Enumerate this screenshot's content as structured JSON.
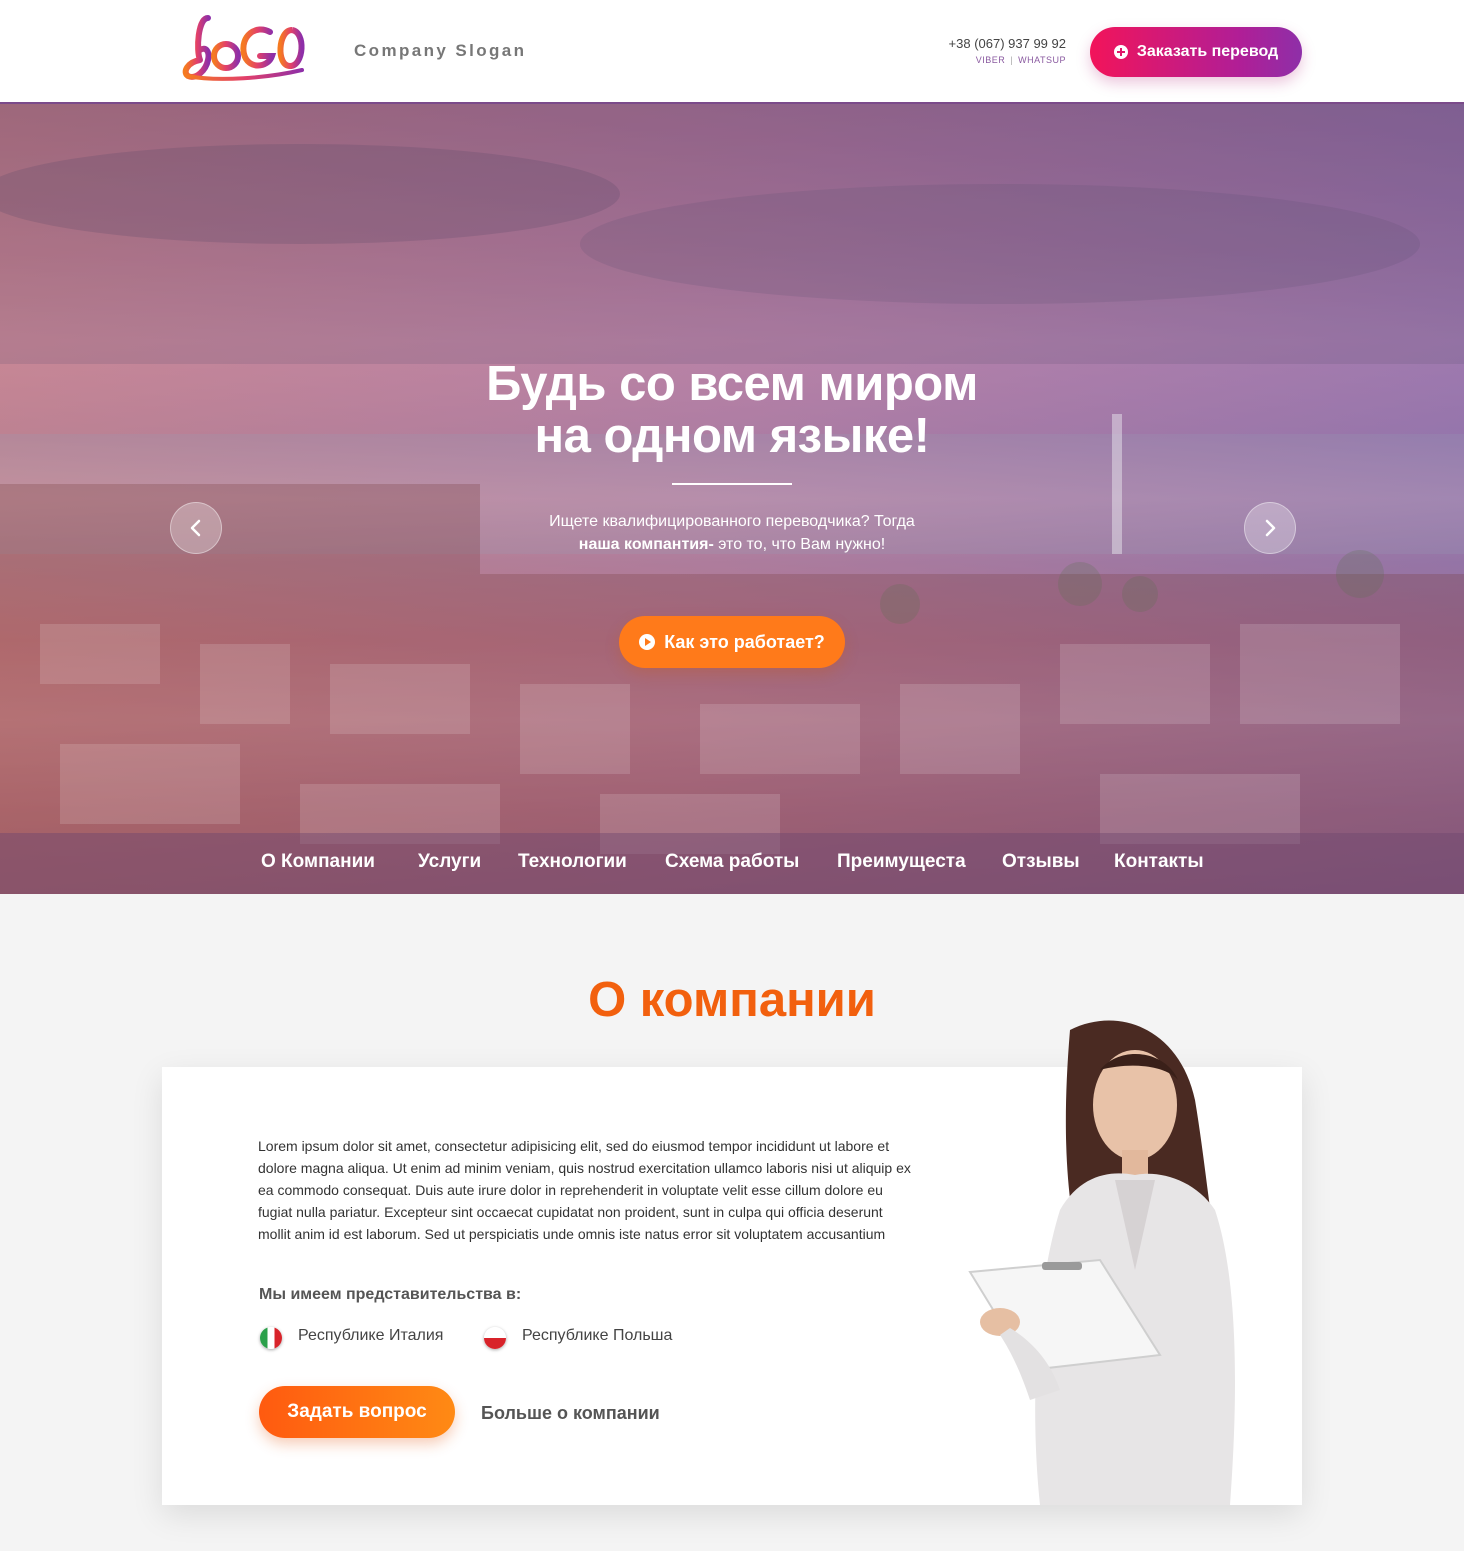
{
  "header": {
    "logo_text": "LoGo",
    "slogan": "Company Slogan",
    "phone": "+38 (067) 937 99 92",
    "phone_viber": "VIBER",
    "phone_sep": "|",
    "phone_whatsup": "WHATSUP",
    "order_button": "Заказать перевод"
  },
  "hero": {
    "title_line1": "Будь со всем миром",
    "title_line2": "на одном языке!",
    "subtitle_line1": "Ищете квалифицированного переводчика? Тогда",
    "subtitle_bold": "наша компантия-",
    "subtitle_rest": " это то, что Вам нужно!",
    "cta_button": "Как это работает?"
  },
  "nav": {
    "items": [
      "О  Компании",
      "Услуги",
      "Технологии",
      "Схема  работы",
      "Преимущеста",
      "Отзывы",
      "Контакты"
    ]
  },
  "about": {
    "title": "О компании",
    "text": "Lorem ipsum dolor sit amet, consectetur adipisicing elit, sed do eiusmod tempor incididunt ut labore et dolore magna aliqua. Ut enim ad minim veniam, quis nostrud exercitation ullamco laboris nisi ut aliquip ex ea commodo consequat. Duis aute irure dolor in reprehenderit in voluptate velit esse cillum dolore eu fugiat nulla pariatur. Excepteur sint occaecat cupidatat non proident, sunt in culpa qui officia deserunt mollit anim id est laborum. Sed ut perspiciatis unde omnis iste natus error sit voluptatem accusantium",
    "reps_label": "Мы имеем представительства в:",
    "countries": [
      "Республике Италия",
      "Республике Польша"
    ],
    "ask_button": "Задать вопрос",
    "more_link": "Больше о компании"
  },
  "colors": {
    "accent_orange": "#ff7a1a",
    "accent_pink": "#f2145a",
    "accent_purple": "#8e2fa8",
    "title_orange": "#f2600e"
  },
  "icons": {
    "order": "plus-circle-icon",
    "cta": "play-circle-icon",
    "prev": "chevron-left-icon",
    "next": "chevron-right-icon"
  }
}
